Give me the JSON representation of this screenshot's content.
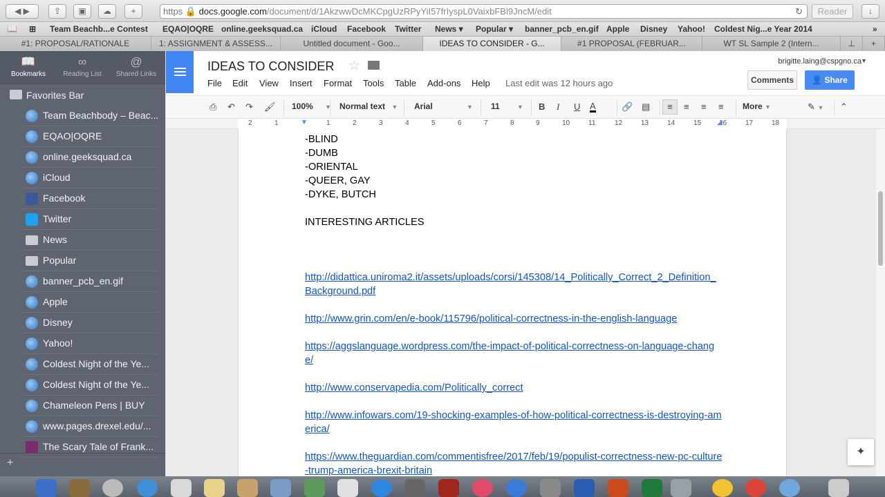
{
  "browser": {
    "address": {
      "scheme": "https",
      "host": "docs.google.com",
      "path": "/document/d/1AkzwwDcMKCpgUzRPyYiI57frIyspL0VaixbFBl9JncM/edit"
    },
    "reader_label": "Reader"
  },
  "bookmarks_bar": [
    "Team Beachb...e Contest",
    "EQAO|OQRE",
    "online.geeksquad.ca",
    "iCloud",
    "Facebook",
    "Twitter",
    "News ▾",
    "Popular ▾",
    "banner_pcb_en.gif",
    "Apple",
    "Disney",
    "Yahoo!",
    "Coldest Nig...e Year 2014"
  ],
  "tabs": [
    {
      "title": "#1: PROPOSAL/RATIONALE"
    },
    {
      "title": "1: ASSIGNMENT & ASSESS..."
    },
    {
      "title": "Untitled document - Goo..."
    },
    {
      "title": "IDEAS TO CONSIDER - G..."
    },
    {
      "title": "#1 PROPOSAL (FEBRUAR..."
    },
    {
      "title": "WT SL Sample 2 (Intern..."
    }
  ],
  "sidebar": {
    "tabs": [
      {
        "label": "Bookmarks",
        "icon": "book-icon"
      },
      {
        "label": "Reading List",
        "icon": "glasses-icon"
      },
      {
        "label": "Shared Links",
        "icon": "at-icon"
      }
    ],
    "folder": "Favorites Bar",
    "items": [
      {
        "label": "Team Beachbody – Beac...",
        "icon": "globe-icon"
      },
      {
        "label": "EQAO|OQRE",
        "icon": "globe-icon"
      },
      {
        "label": "online.geeksquad.ca",
        "icon": "globe-icon"
      },
      {
        "label": "iCloud",
        "icon": "globe-icon"
      },
      {
        "label": "Facebook",
        "icon": "facebook-icon"
      },
      {
        "label": "Twitter",
        "icon": "twitter-icon"
      },
      {
        "label": "News",
        "icon": "folder-icon"
      },
      {
        "label": "Popular",
        "icon": "folder-icon"
      },
      {
        "label": "banner_pcb_en.gif",
        "icon": "globe-icon"
      },
      {
        "label": "Apple",
        "icon": "globe-icon"
      },
      {
        "label": "Disney",
        "icon": "globe-icon"
      },
      {
        "label": "Yahoo!",
        "icon": "globe-icon"
      },
      {
        "label": "Coldest Night of the Ye...",
        "icon": "globe-icon"
      },
      {
        "label": "Coldest Night of the Ye...",
        "icon": "globe-icon"
      },
      {
        "label": "Chameleon Pens | BUY",
        "icon": "globe-icon"
      },
      {
        "label": "www.pages.drexel.edu/...",
        "icon": "globe-icon"
      },
      {
        "label": "The Scary Tale of Frank...",
        "icon": "bs-icon"
      }
    ]
  },
  "docs": {
    "title": "IDEAS TO CONSIDER",
    "menus": [
      "File",
      "Edit",
      "View",
      "Insert",
      "Format",
      "Tools",
      "Table",
      "Add-ons",
      "Help"
    ],
    "last_edit": "Last edit was 12 hours ago",
    "account": "brigitte.laing@cspgno.ca",
    "comments_label": "Comments",
    "share_label": "Share",
    "toolbar": {
      "zoom": "100%",
      "style": "Normal text",
      "font": "Arial",
      "size": "11",
      "more": "More"
    },
    "ruler": [
      "2",
      "1",
      "1",
      "2",
      "3",
      "4",
      "5",
      "6",
      "7",
      "8",
      "9",
      "10",
      "11",
      "12",
      "13",
      "14",
      "15",
      "16",
      "17",
      "18"
    ]
  },
  "document": {
    "lines": [
      "-BLIND",
      "-DUMB",
      "-ORIENTAL",
      "-QUEER, GAY",
      "-DYKE, BUTCH"
    ],
    "heading": "INTERESTING ARTICLES",
    "links": [
      "http://didattica.uniroma2.it/assets/uploads/corsi/145308/14_Politically_Correct_2_Definition_Background.pdf",
      "http://www.grin.com/en/e-book/115796/political-correctness-in-the-english-language",
      "https://aggslanguage.wordpress.com/the-impact-of-political-correctness-on-language-change/",
      "http://www.conservapedia.com/Politically_correct",
      "http://www.infowars.com/19-shocking-examples-of-how-political-correctness-is-destroying-america/",
      "https://www.theguardian.com/commentisfree/2017/feb/19/populist-correctness-new-pc-culture-trump-america-brexit-britain"
    ]
  },
  "colors": {
    "docs_blue": "#4285f4",
    "link": "#1155cc",
    "sidebar_bg": "#5f6570"
  }
}
